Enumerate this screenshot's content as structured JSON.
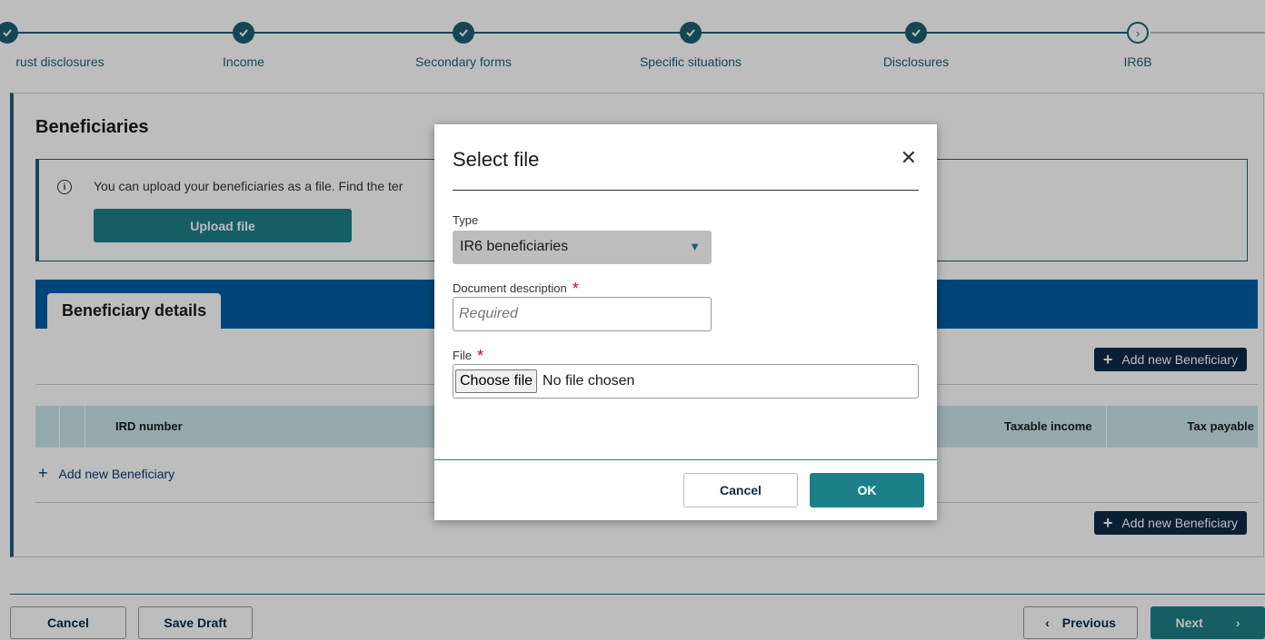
{
  "stepper": {
    "steps": [
      {
        "label": "rust disclosures",
        "state": "complete"
      },
      {
        "label": "Income",
        "state": "complete"
      },
      {
        "label": "Secondary forms",
        "state": "complete"
      },
      {
        "label": "Specific situations",
        "state": "complete"
      },
      {
        "label": "Disclosures",
        "state": "complete"
      },
      {
        "label": "IR6B",
        "state": "current"
      }
    ]
  },
  "page": {
    "title": "Beneficiaries",
    "info_text": "You can upload your beneficiaries as a file. Find the ter",
    "upload_button": "Upload file",
    "tab_label": "Beneficiary details",
    "add_new_button": "Add new Beneficiary",
    "table_headers": {
      "ird_number": "IRD number",
      "taxable_income": "Taxable income",
      "tax_payable": "Tax payable"
    },
    "add_new_link": "Add new Beneficiary"
  },
  "footer": {
    "cancel": "Cancel",
    "save_draft": "Save Draft",
    "previous": "Previous",
    "next": "Next"
  },
  "modal": {
    "title": "Select file",
    "type_label": "Type",
    "type_value": "IR6 beneficiaries",
    "description_label": "Document description",
    "description_placeholder": "Required",
    "file_label": "File",
    "choose_file": "Choose file",
    "no_file": "No file chosen",
    "cancel": "Cancel",
    "ok": "OK",
    "required_marker": "*"
  },
  "colors": {
    "primary_teal": "#1d7f88",
    "dark_teal": "#1d5f74",
    "blue_bar": "#005ea5",
    "navy": "#0b2a4a",
    "required_red": "#d0021b"
  }
}
